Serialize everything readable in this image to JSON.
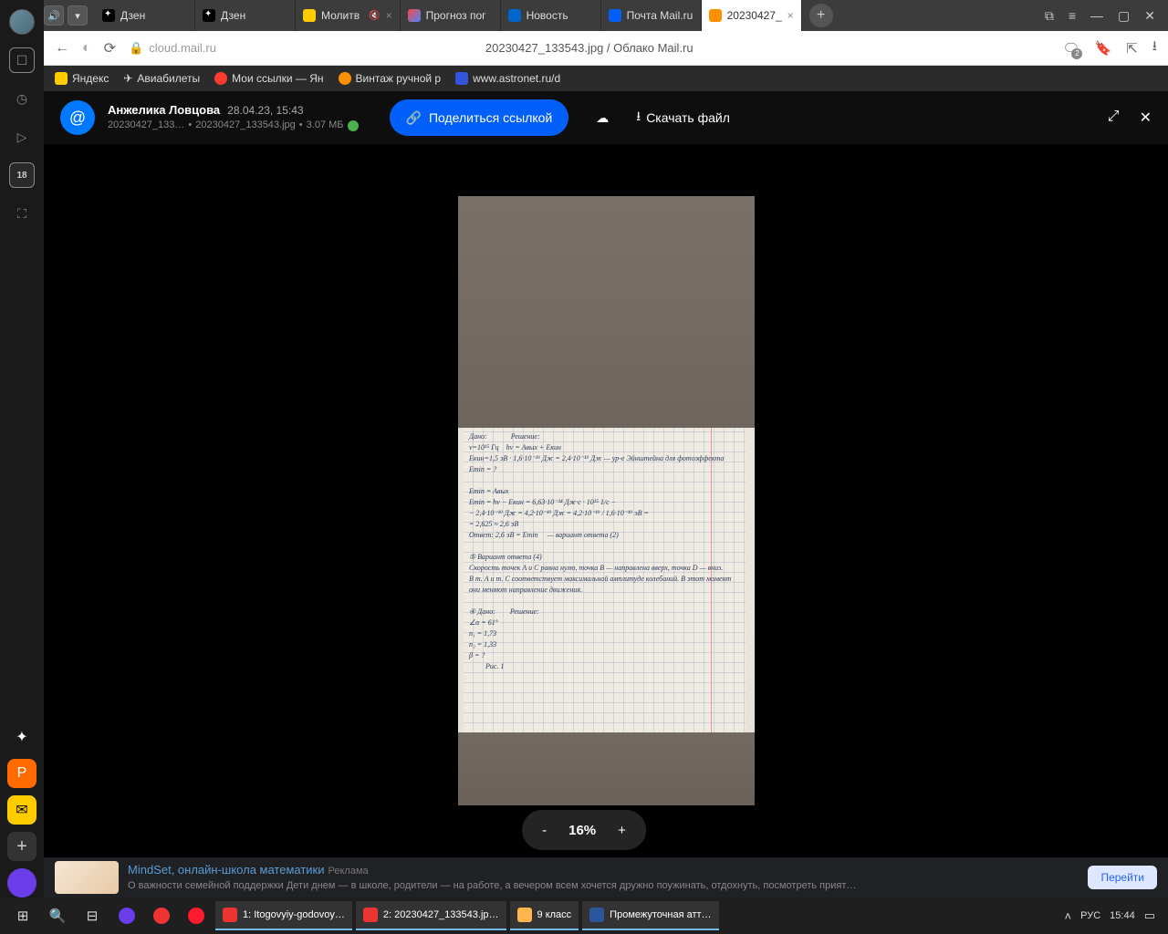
{
  "sidebar": {
    "badge": "18"
  },
  "tabs": {
    "items": [
      {
        "label": "Дзен"
      },
      {
        "label": "Дзен"
      },
      {
        "label": "Молитв"
      },
      {
        "label": "Прогноз пог"
      },
      {
        "label": "Новость"
      },
      {
        "label": "Почта Mail.ru"
      },
      {
        "label": "20230427_"
      }
    ]
  },
  "address": {
    "url": "cloud.mail.ru",
    "title": "20230427_133543.jpg / Облако Mail.ru",
    "notif": "2"
  },
  "bookmarks": {
    "items": [
      {
        "label": "Яндекс"
      },
      {
        "label": "Авиабилеты"
      },
      {
        "label": "Мои ссылки — Ян"
      },
      {
        "label": "Винтаж ручной р"
      },
      {
        "label": "www.astronet.ru/d"
      }
    ]
  },
  "cloud": {
    "user": "Анжелика Ловцова",
    "date": "28.04.23, 15:43",
    "file_short": "20230427_133…",
    "file_full": "20230427_133543.jpg",
    "size": "3.07 МБ",
    "share": "Поделиться ссылкой",
    "download": "Скачать файл"
  },
  "zoom": {
    "minus": "-",
    "pct": "16%",
    "plus": "+"
  },
  "ad": {
    "title": "MindSet, онлайн-школа математики",
    "tag": "Реклама",
    "body": "О важности семейной поддержки Дети днем — в школе, родители — на работе, а вечером всем хочется дружно поужинать, отдохнуть, посмотреть прият…",
    "go": "Перейти"
  },
  "taskbar": {
    "apps": [
      {
        "label": "1: Itogovyiy-godovoy…"
      },
      {
        "label": "2: 20230427_133543.jp…"
      },
      {
        "label": "9 класс"
      },
      {
        "label": "Промежуточная атт…"
      }
    ],
    "lang": "РУС",
    "time": "15:44"
  }
}
